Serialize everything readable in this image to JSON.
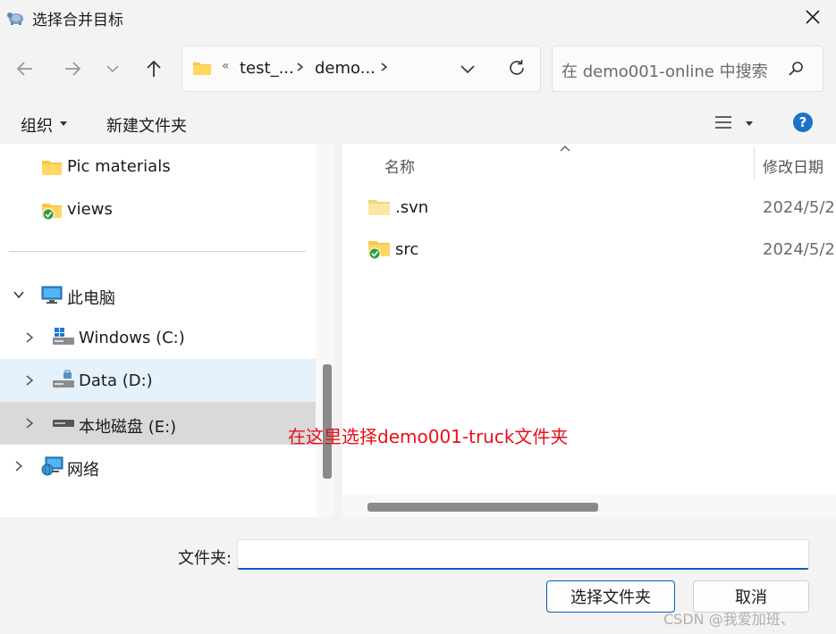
{
  "window": {
    "title": "选择合并目标"
  },
  "address": {
    "overflow": "«",
    "segments": [
      "test_...",
      "demo..."
    ]
  },
  "search": {
    "placeholder": "在 demo001-online 中搜索"
  },
  "toolbar": {
    "organize": "组织",
    "new_folder": "新建文件夹"
  },
  "tree": {
    "items": [
      {
        "label": "Pic materials",
        "icon": "folder-icon"
      },
      {
        "label": "views",
        "icon": "svn-folder-icon"
      },
      {
        "label": "此电脑",
        "icon": "monitor-icon",
        "expanded": true
      },
      {
        "label": "Windows (C:)",
        "icon": "windows-drive-icon"
      },
      {
        "label": "Data (D:)",
        "icon": "drive-icon"
      },
      {
        "label": "本地磁盘 (E:)",
        "icon": "drive-icon"
      },
      {
        "label": "网络",
        "icon": "network-icon"
      }
    ]
  },
  "files": {
    "headers": {
      "name": "名称",
      "date": "修改日期"
    },
    "rows": [
      {
        "name": ".svn",
        "date": "2024/5/2",
        "icon": "folder-icon"
      },
      {
        "name": "src",
        "date": "2024/5/2",
        "icon": "svn-folder-icon"
      }
    ]
  },
  "footer": {
    "folder_label": "文件夹:",
    "folder_value": "",
    "select_button": "选择文件夹",
    "cancel_button": "取消"
  },
  "annotation": "在这里选择demo001-truck文件夹",
  "watermark": "CSDN @我爱加班、",
  "colors": {
    "accent": "#005fb8",
    "folder": "#f6c744",
    "annotation": "#e8101a",
    "selection": "#e5f1fb"
  }
}
